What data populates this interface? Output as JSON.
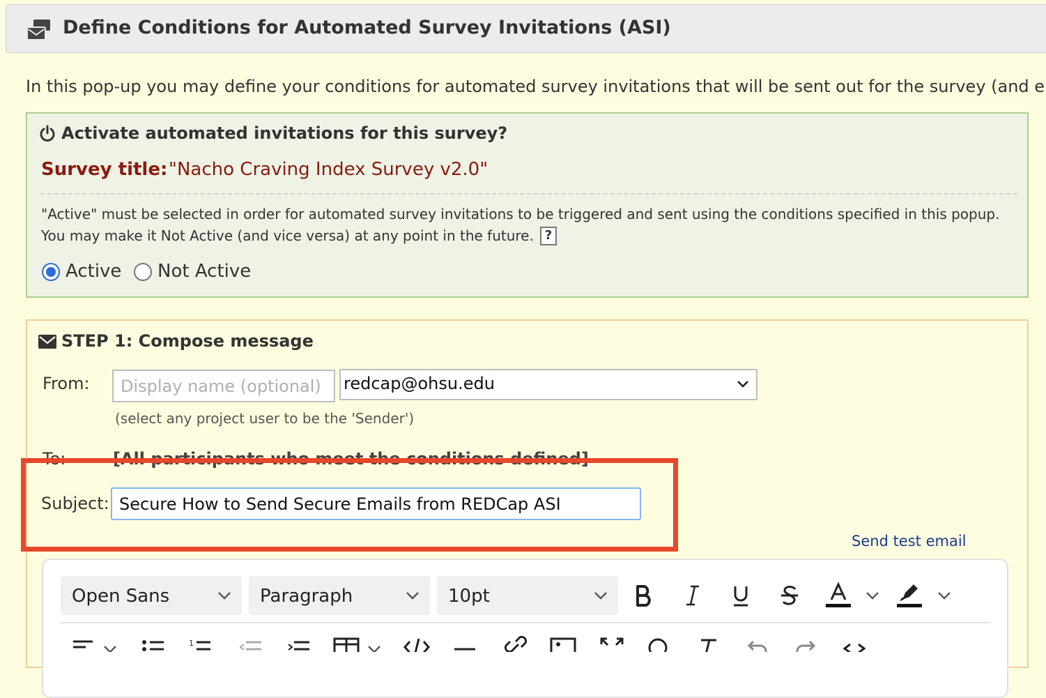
{
  "header": {
    "title": "Define Conditions for Automated Survey Invitations (ASI)",
    "icon": "envelope-stack-icon"
  },
  "intro": "In this pop-up you may define your conditions for automated survey invitations that will be sent out for the survey (and e",
  "activation": {
    "title": "Activate automated invitations for this survey?",
    "survey_label": "Survey title:",
    "survey_value": "\"Nacho Craving Index Survey v2.0\"",
    "note_line1": "\"Active\" must be selected in order for automated survey invitations to be triggered and sent using the conditions specified in this popup.",
    "note_line2": "You may make it Not Active (and vice versa) at any point in the future.",
    "help_label": "?",
    "options": [
      {
        "label": "Active",
        "selected": true
      },
      {
        "label": "Not Active",
        "selected": false
      }
    ]
  },
  "step1": {
    "title": "STEP 1: Compose message",
    "from_label": "From:",
    "display_name_placeholder": "Display name (optional)",
    "from_email": "redcap@ohsu.edu",
    "sender_note": "(select any project user to be the 'Sender')",
    "to_label": "To:",
    "to_value": "[All participants who meet the conditions defined]",
    "subject_label": "Subject:",
    "subject_value": "Secure How to Send Secure Emails from REDCap ASI",
    "send_test": "Send test email"
  },
  "editor": {
    "font": "Open Sans",
    "block": "Paragraph",
    "size": "10pt"
  },
  "colors": {
    "accent_red": "#8b1a0e",
    "highlight": "#e8472a",
    "link": "#1a3c8f",
    "radio": "#2a6bd8"
  }
}
